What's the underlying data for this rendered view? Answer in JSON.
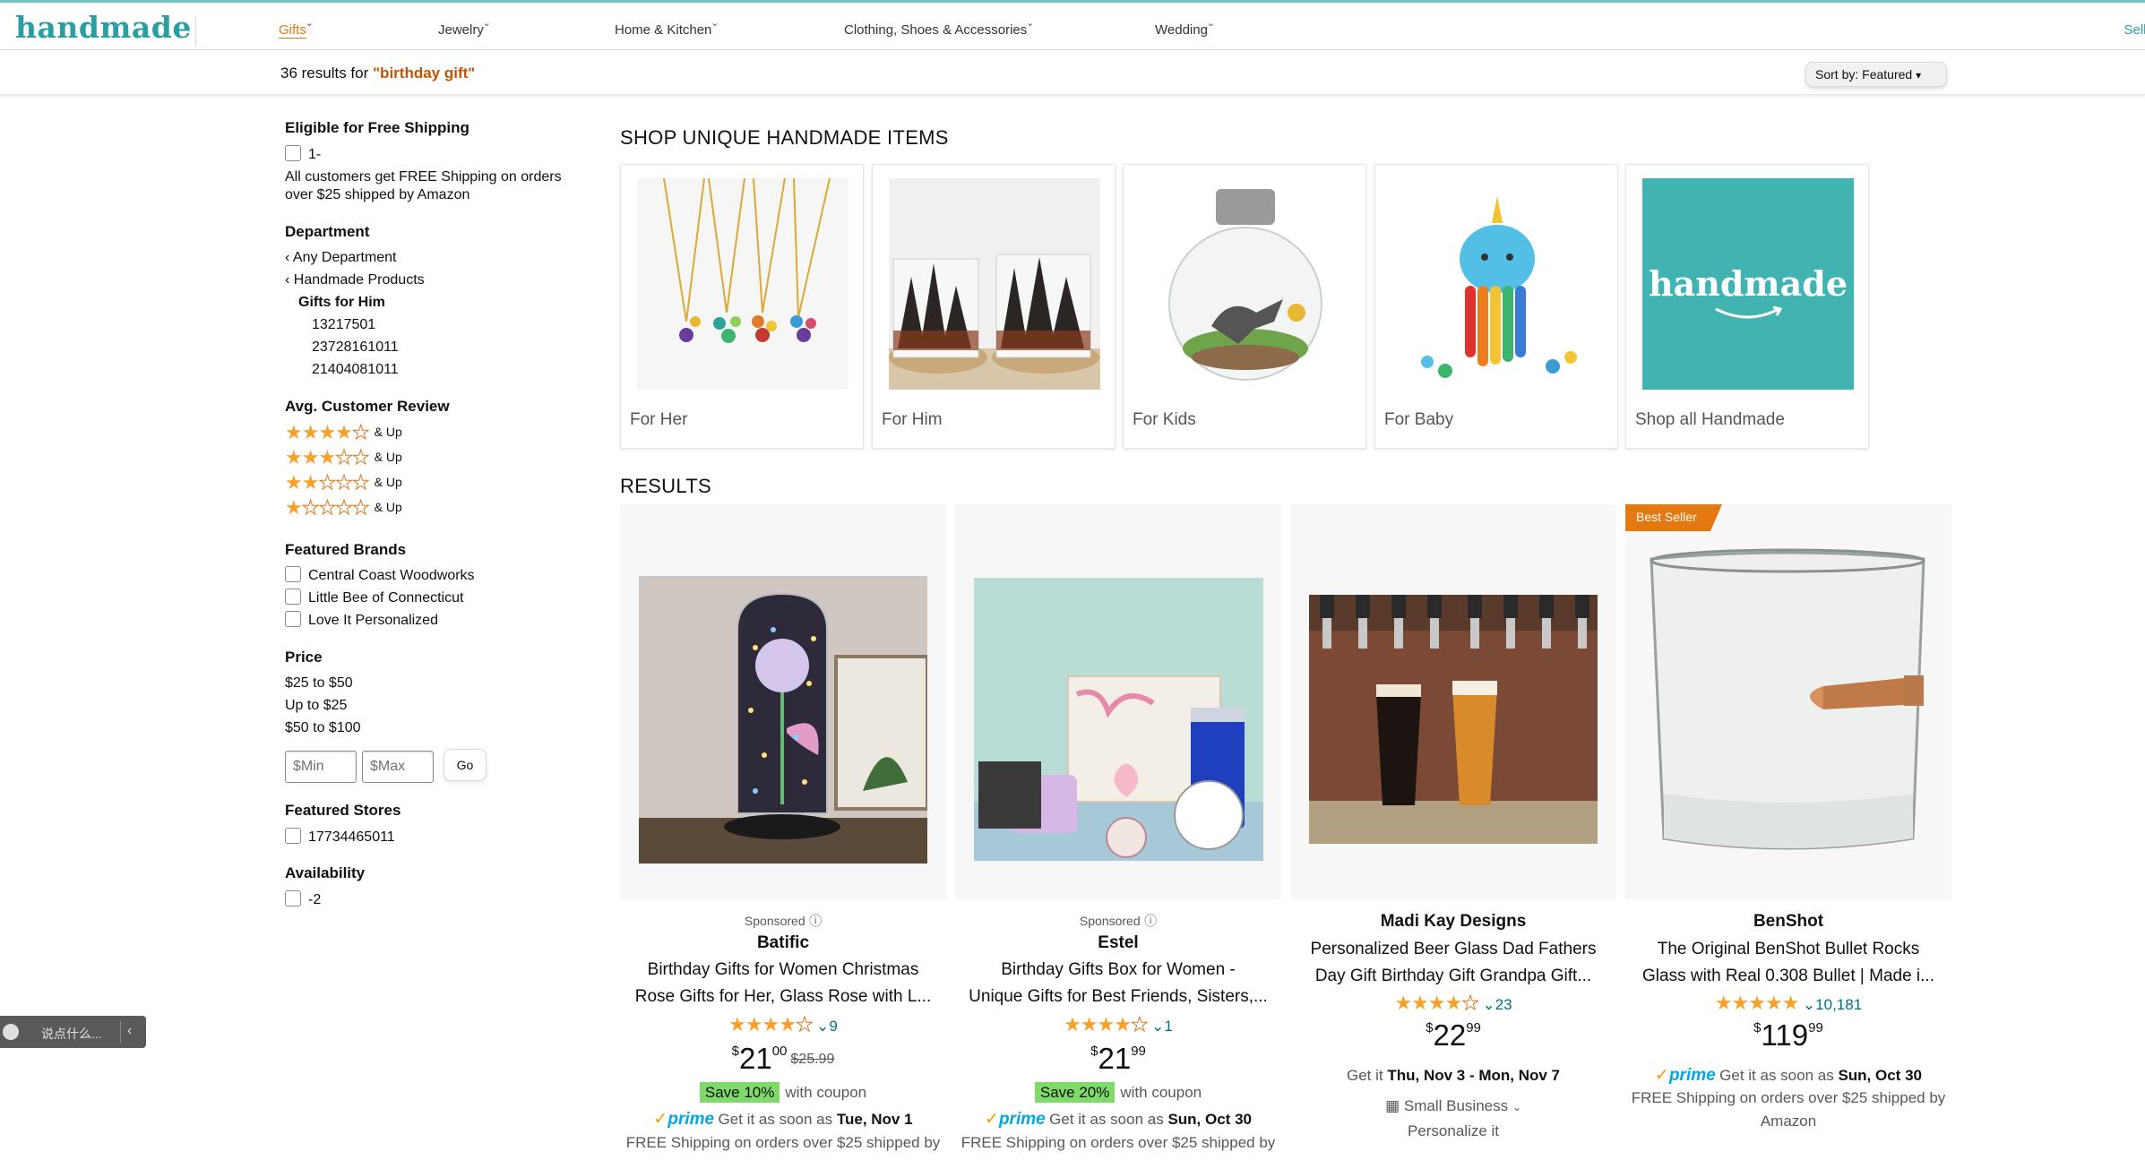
{
  "nav": {
    "logo": "handmade",
    "items": [
      {
        "label": "Gifts",
        "active": true
      },
      {
        "label": "Jewelry"
      },
      {
        "label": "Home & Kitchen"
      },
      {
        "label": "Clothing, Shoes & Accessories"
      },
      {
        "label": "Wedding"
      }
    ],
    "sell": "Sell o"
  },
  "results": {
    "count_prefix": "36 results for ",
    "query": "\"birthday gift\"",
    "sort_label": "Sort by:",
    "sort_value": "Featured"
  },
  "sidebar": {
    "free_shipping": {
      "title": "Eligible for Free Shipping",
      "option": "1-",
      "note_line1": "All customers get FREE Shipping on orders",
      "note_line2": "over $25 shipped by Amazon"
    },
    "department": {
      "title": "Department",
      "any": "Any Department",
      "handmade": "Handmade Products",
      "gifts_for_him": "Gifts for Him",
      "subs": [
        "13217501",
        "23728161011",
        "21404081011"
      ]
    },
    "reviews": {
      "title": "Avg. Customer Review",
      "rows": [
        {
          "stars": 4,
          "label": "& Up"
        },
        {
          "stars": 3,
          "label": "& Up"
        },
        {
          "stars": 2,
          "label": "& Up"
        },
        {
          "stars": 1,
          "label": "& Up"
        }
      ]
    },
    "brands": {
      "title": "Featured Brands",
      "items": [
        "Central Coast Woodworks",
        "Little Bee of Connecticut",
        "Love It Personalized"
      ]
    },
    "price": {
      "title": "Price",
      "ranges": [
        "$25 to $50",
        "Up to $25",
        "$50 to $100"
      ],
      "min_placeholder": "$Min",
      "max_placeholder": "$Max",
      "go": "Go"
    },
    "stores": {
      "title": "Featured Stores",
      "items": [
        "17734465011"
      ]
    },
    "availability": {
      "title": "Availability",
      "items": [
        "-2"
      ]
    }
  },
  "shop_unique": {
    "title": "SHOP UNIQUE HANDMADE ITEMS",
    "tiles": [
      {
        "label": "For Her"
      },
      {
        "label": "For Him"
      },
      {
        "label": "For Kids"
      },
      {
        "label": "For Baby"
      },
      {
        "label": "Shop all Handmade",
        "logo_text": "handmade"
      }
    ]
  },
  "results_title": "RESULTS",
  "products": [
    {
      "sponsored": "Sponsored",
      "brand": "Batific",
      "title_line1": "Birthday Gifts for Women Christmas",
      "title_line2": "Rose Gifts for Her, Glass Rose with L...",
      "rating": 4.5,
      "rating_count": "9",
      "price_symbol": "$",
      "price_whole": "21",
      "price_frac": "00",
      "list_price": "$25.99",
      "save": "Save 10%",
      "coupon": "with coupon",
      "prime": "prime",
      "delivery_prefix": "Get it as soon as",
      "delivery_date": "Tue, Nov 1",
      "shipping": "FREE Shipping on orders over $25 shipped by"
    },
    {
      "sponsored": "Sponsored",
      "brand": "Estel",
      "title_line1": "Birthday Gifts Box for Women -",
      "title_line2": "Unique Gifts for Best Friends, Sisters,...",
      "rating": 4.5,
      "rating_count": "1",
      "price_symbol": "$",
      "price_whole": "21",
      "price_frac": "99",
      "save": "Save 20%",
      "coupon": "with coupon",
      "prime": "prime",
      "delivery_prefix": "Get it as soon as",
      "delivery_date": "Sun, Oct 30",
      "shipping": "FREE Shipping on orders over $25 shipped by"
    },
    {
      "brand": "Madi Kay Designs",
      "title_line1": "Personalized Beer Glass Dad Fathers",
      "title_line2": "Day Gift Birthday Gift Grandpa Gift...",
      "rating": 4.5,
      "rating_count": "23",
      "price_symbol": "$",
      "price_whole": "22",
      "price_frac": "99",
      "delivery_prefix": "Get it",
      "delivery_date": "Thu, Nov 3 - Mon, Nov 7",
      "small_business": "Small Business",
      "personalize": "Personalize it"
    },
    {
      "badge": "Best Seller",
      "brand": "BenShot",
      "title_line1": "The Original BenShot Bullet Rocks",
      "title_line2": "Glass with Real 0.308 Bullet | Made i...",
      "rating": 5,
      "rating_count": "10,181",
      "price_symbol": "$",
      "price_whole": "119",
      "price_frac": "99",
      "prime": "prime",
      "delivery_prefix": "Get it as soon as",
      "delivery_date": "Sun, Oct 30",
      "shipping_line1": "FREE Shipping on orders over $25 shipped by",
      "shipping_line2": "Amazon"
    }
  ],
  "chat_widget": {
    "text": "说点什么..."
  },
  "colors": {
    "brand_teal": "#2a9fa1",
    "accent_orange": "#e47911",
    "star": "#f7a12b",
    "link": "#007185",
    "save_green": "#7fda69",
    "prime_blue": "#00a8e1"
  }
}
